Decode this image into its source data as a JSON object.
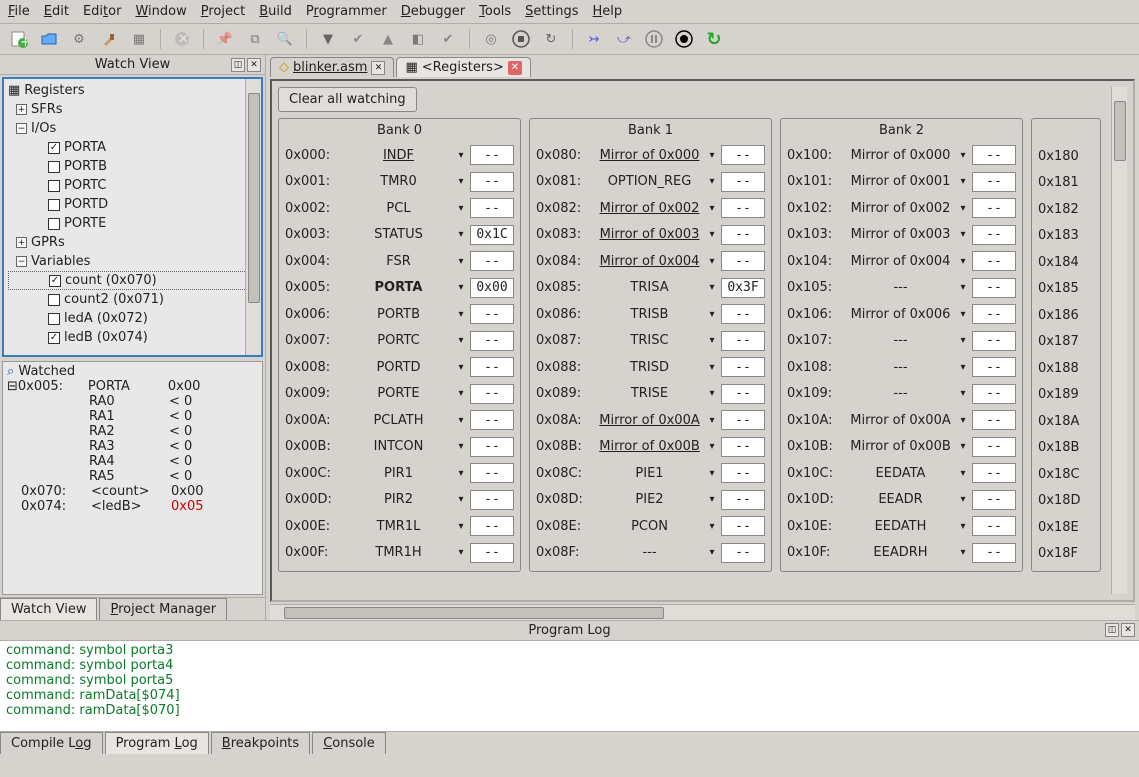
{
  "menu": {
    "file": "File",
    "edit": "Edit",
    "editor": "Editor",
    "window": "Window",
    "project": "Project",
    "build": "Build",
    "programmer": "Programmer",
    "debugger": "Debugger",
    "tools": "Tools",
    "settings": "Settings",
    "help": "Help"
  },
  "panel": {
    "watch_view": "Watch View"
  },
  "tree": {
    "root": "Registers",
    "sfrs": "SFRs",
    "ios": "I/Os",
    "porta": "PORTA",
    "portb": "PORTB",
    "portc": "PORTC",
    "portd": "PORTD",
    "porte": "PORTE",
    "gprs": "GPRs",
    "variables": "Variables",
    "count": "count (0x070)",
    "count2": "count2 (0x071)",
    "ledA": "ledA (0x072)",
    "ledB": "ledB (0x074)"
  },
  "watched": {
    "title": "Watched",
    "addr005": "0x005:",
    "porta": "PORTA",
    "porta_val": "0x00",
    "ra0": "RA0",
    "ra1": "RA1",
    "ra2": "RA2",
    "ra3": "RA3",
    "ra4": "RA4",
    "ra5": "RA5",
    "lt0": "< 0",
    "addr070": "0x070:",
    "count": "<count>",
    "count_val": "0x00",
    "addr074": "0x074:",
    "ledb": "<ledB>",
    "ledb_val": "0x05"
  },
  "left_tabs": {
    "watch_view": "Watch View",
    "project_manager": "Project Manager"
  },
  "file_tabs": {
    "blinker": "blinker.asm",
    "registers": "<Registers>"
  },
  "regview": {
    "clear": "Clear all watching"
  },
  "banks": {
    "b0": {
      "title": "Bank 0",
      "rows": [
        {
          "addr": "0x000:",
          "name": "INDF",
          "val": "--",
          "u": true
        },
        {
          "addr": "0x001:",
          "name": "TMR0",
          "val": "--"
        },
        {
          "addr": "0x002:",
          "name": "PCL",
          "val": "--"
        },
        {
          "addr": "0x003:",
          "name": "STATUS",
          "val": "0x1C"
        },
        {
          "addr": "0x004:",
          "name": "FSR",
          "val": "--"
        },
        {
          "addr": "0x005:",
          "name": "PORTA",
          "val": "0x00",
          "bold": true
        },
        {
          "addr": "0x006:",
          "name": "PORTB",
          "val": "--"
        },
        {
          "addr": "0x007:",
          "name": "PORTC",
          "val": "--"
        },
        {
          "addr": "0x008:",
          "name": "PORTD",
          "val": "--"
        },
        {
          "addr": "0x009:",
          "name": "PORTE",
          "val": "--"
        },
        {
          "addr": "0x00A:",
          "name": "PCLATH",
          "val": "--"
        },
        {
          "addr": "0x00B:",
          "name": "INTCON",
          "val": "--"
        },
        {
          "addr": "0x00C:",
          "name": "PIR1",
          "val": "--"
        },
        {
          "addr": "0x00D:",
          "name": "PIR2",
          "val": "--"
        },
        {
          "addr": "0x00E:",
          "name": "TMR1L",
          "val": "--"
        },
        {
          "addr": "0x00F:",
          "name": "TMR1H",
          "val": "--"
        }
      ]
    },
    "b1": {
      "title": "Bank 1",
      "rows": [
        {
          "addr": "0x080:",
          "name": "Mirror of 0x000",
          "val": "--",
          "u": true
        },
        {
          "addr": "0x081:",
          "name": "OPTION_REG",
          "val": "--"
        },
        {
          "addr": "0x082:",
          "name": "Mirror of 0x002",
          "val": "--",
          "u": true
        },
        {
          "addr": "0x083:",
          "name": "Mirror of 0x003",
          "val": "--",
          "u": true
        },
        {
          "addr": "0x084:",
          "name": "Mirror of 0x004",
          "val": "--",
          "u": true
        },
        {
          "addr": "0x085:",
          "name": "TRISA",
          "val": "0x3F"
        },
        {
          "addr": "0x086:",
          "name": "TRISB",
          "val": "--"
        },
        {
          "addr": "0x087:",
          "name": "TRISC",
          "val": "--"
        },
        {
          "addr": "0x088:",
          "name": "TRISD",
          "val": "--"
        },
        {
          "addr": "0x089:",
          "name": "TRISE",
          "val": "--"
        },
        {
          "addr": "0x08A:",
          "name": "Mirror of 0x00A",
          "val": "--",
          "u": true
        },
        {
          "addr": "0x08B:",
          "name": "Mirror of 0x00B",
          "val": "--",
          "u": true
        },
        {
          "addr": "0x08C:",
          "name": "PIE1",
          "val": "--"
        },
        {
          "addr": "0x08D:",
          "name": "PIE2",
          "val": "--"
        },
        {
          "addr": "0x08E:",
          "name": "PCON",
          "val": "--"
        },
        {
          "addr": "0x08F:",
          "name": "---",
          "val": "--"
        }
      ]
    },
    "b2": {
      "title": "Bank 2",
      "rows": [
        {
          "addr": "0x100:",
          "name": "Mirror of 0x000",
          "val": "--"
        },
        {
          "addr": "0x101:",
          "name": "Mirror of 0x001",
          "val": "--"
        },
        {
          "addr": "0x102:",
          "name": "Mirror of 0x002",
          "val": "--"
        },
        {
          "addr": "0x103:",
          "name": "Mirror of 0x003",
          "val": "--"
        },
        {
          "addr": "0x104:",
          "name": "Mirror of 0x004",
          "val": "--"
        },
        {
          "addr": "0x105:",
          "name": "---",
          "val": "--"
        },
        {
          "addr": "0x106:",
          "name": "Mirror of 0x006",
          "val": "--"
        },
        {
          "addr": "0x107:",
          "name": "---",
          "val": "--"
        },
        {
          "addr": "0x108:",
          "name": "---",
          "val": "--"
        },
        {
          "addr": "0x109:",
          "name": "---",
          "val": "--"
        },
        {
          "addr": "0x10A:",
          "name": "Mirror of 0x00A",
          "val": "--"
        },
        {
          "addr": "0x10B:",
          "name": "Mirror of 0x00B",
          "val": "--"
        },
        {
          "addr": "0x10C:",
          "name": "EEDATA",
          "val": "--"
        },
        {
          "addr": "0x10D:",
          "name": "EEADR",
          "val": "--"
        },
        {
          "addr": "0x10E:",
          "name": "EEDATH",
          "val": "--"
        },
        {
          "addr": "0x10F:",
          "name": "EEADRH",
          "val": "--"
        }
      ]
    },
    "b3": {
      "rows": [
        {
          "addr": "0x180"
        },
        {
          "addr": "0x181"
        },
        {
          "addr": "0x182"
        },
        {
          "addr": "0x183"
        },
        {
          "addr": "0x184"
        },
        {
          "addr": "0x185"
        },
        {
          "addr": "0x186"
        },
        {
          "addr": "0x187"
        },
        {
          "addr": "0x188"
        },
        {
          "addr": "0x189"
        },
        {
          "addr": "0x18A"
        },
        {
          "addr": "0x18B"
        },
        {
          "addr": "0x18C"
        },
        {
          "addr": "0x18D"
        },
        {
          "addr": "0x18E"
        },
        {
          "addr": "0x18F"
        }
      ]
    }
  },
  "proglog": {
    "title": "Program Log",
    "lines": [
      "command: symbol porta3",
      "command: symbol porta4",
      "command: symbol porta5",
      "command: ramData[$074]",
      "command: ramData[$070]"
    ]
  },
  "foot_tabs": {
    "compile": "Compile Log",
    "program": "Program Log",
    "breakpoints": "Breakpoints",
    "console": "Console"
  }
}
